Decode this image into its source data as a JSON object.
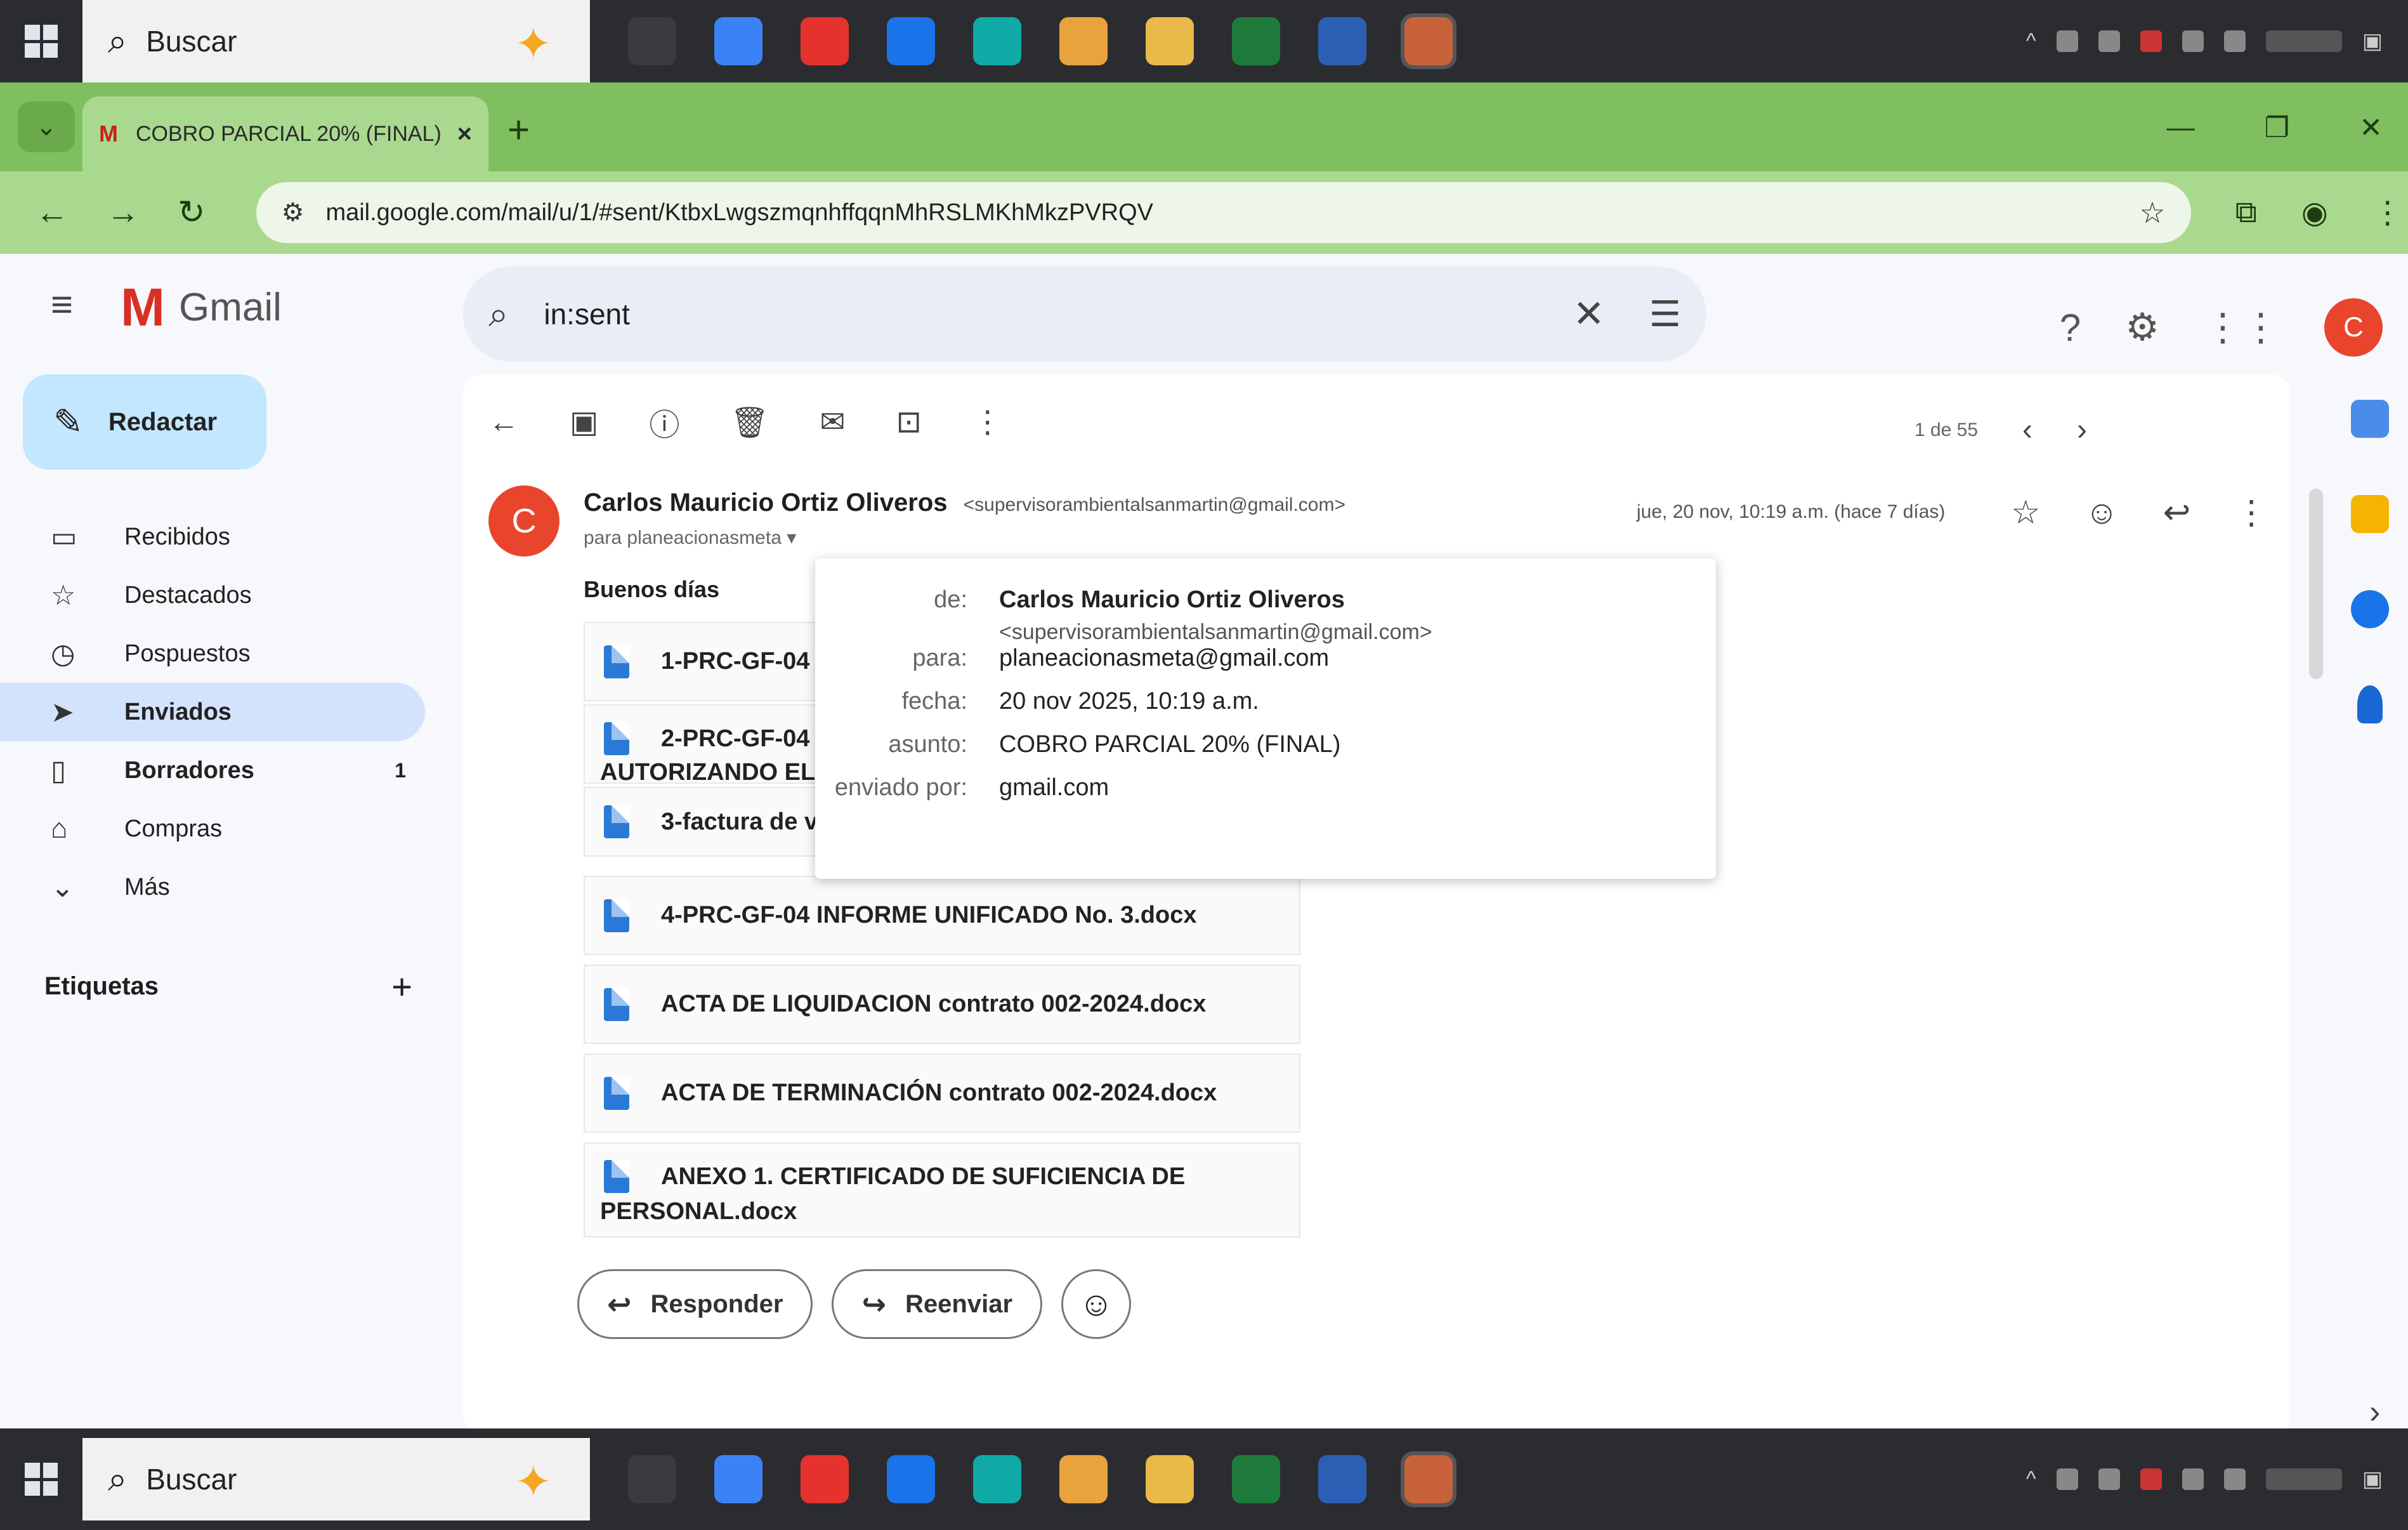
{
  "taskbar": {
    "search_label": "Buscar",
    "apps": [
      "task-view-icon",
      "copilot-icon",
      "opera-icon",
      "outlook-icon",
      "edge-icon",
      "chrome-icon",
      "file-explorer-icon",
      "excel-icon",
      "word-icon",
      "store-icon"
    ],
    "app_colors": [
      "#3a3b3f",
      "#3b82f6",
      "#e5322d",
      "#1a73e8",
      "#0fa9a6",
      "#e8a33d",
      "#e9b949",
      "#1e7a3a",
      "#2b5fb3",
      "#c8623a"
    ]
  },
  "browser": {
    "tab_title": "COBRO PARCIAL 20% (FINAL)",
    "tab_favicon": "M",
    "tab_close": "×",
    "new_tab": "+",
    "url": "mail.google.com/mail/u/1/#sent/KtbxLwgszmqnhffqqnMhRSLMKhMkzPVRQV",
    "theme_color": "#7fbf5f"
  },
  "gmail": {
    "app_name": "Gmail",
    "search_query": "in:sent",
    "compose_label": "Redactar",
    "nav": [
      {
        "label": "Recibidos",
        "icon": "inbox-icon",
        "glyph": "▭",
        "count": ""
      },
      {
        "label": "Destacados",
        "icon": "star-icon",
        "glyph": "☆",
        "count": ""
      },
      {
        "label": "Pospuestos",
        "icon": "clock-icon",
        "glyph": "◷",
        "count": ""
      },
      {
        "label": "Enviados",
        "icon": "send-icon",
        "glyph": "➤",
        "count": ""
      },
      {
        "label": "Borradores",
        "icon": "draft-icon",
        "glyph": "▯",
        "count": "1"
      },
      {
        "label": "Compras",
        "icon": "shopping-tag-icon",
        "glyph": "⌂",
        "count": ""
      },
      {
        "label": "Más",
        "icon": "chevron-down-icon",
        "glyph": "⌄",
        "count": ""
      }
    ],
    "labels_heading": "Etiquetas",
    "avatar_letter": "C"
  },
  "message": {
    "pager": "1 de 55",
    "sender_initial": "C",
    "sender_name": "Carlos Mauricio Ortiz Oliveros",
    "sender_email": "<supervisorambientalsanmartin@gmail.com>",
    "to_short": "para planeacionasmeta",
    "date_short": "jue, 20 nov, 10:19 a.m. (hace 7 días)",
    "greeting": "Buenos días",
    "attachments": [
      "1-PRC-GF-04",
      "2-PRC-GF-04",
      "AUTORIZANDO EL",
      "3-factura de v",
      "4-PRC-GF-04 INFORME UNIFICADO No. 3.docx",
      "ACTA DE LIQUIDACION contrato 002-2024.docx",
      "ACTA DE TERMINACIÓN contrato 002-2024.docx",
      "ANEXO 1. CERTIFICADO DE SUFICIENCIA DE",
      "PERSONAL.docx"
    ],
    "reply_label": "Responder",
    "forward_label": "Reenviar"
  },
  "details_popup": {
    "from_key": "de:",
    "from_name": "Carlos Mauricio Ortiz Oliveros",
    "from_email": "<supervisorambientalsanmartin@gmail.com>",
    "to_key": "para:",
    "to_value": "planeacionasmeta@gmail.com",
    "date_key": "fecha:",
    "date_value": "20 nov 2025, 10:19 a.m.",
    "subject_key": "asunto:",
    "subject_value": "COBRO PARCIAL 20% (FINAL)",
    "sent_by_key": "enviado por:",
    "sent_by_value": "gmail.com"
  }
}
